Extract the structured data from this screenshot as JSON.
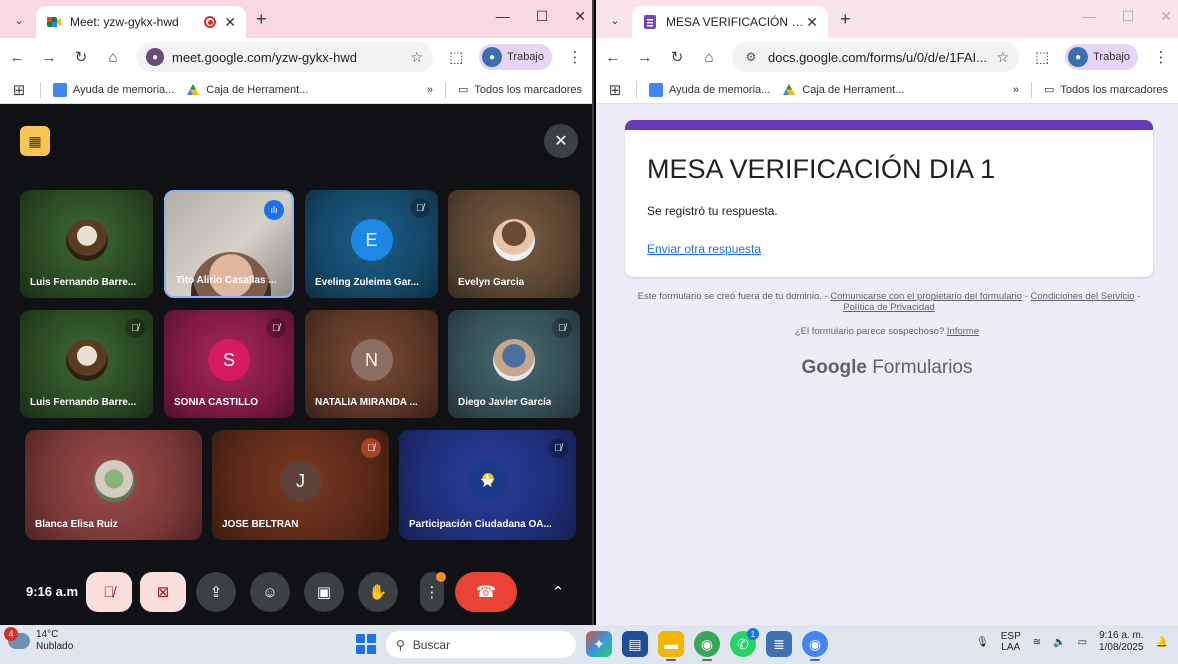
{
  "left_window": {
    "tab_title": "Meet: yzw-gykx-hwd",
    "url": "meet.google.com/yzw-gykx-hwd",
    "profile": "Trabajo",
    "bookmarks": [
      "Ayuda de memoria...",
      "Caja de Herrament..."
    ],
    "all_bookmarks": "Todos los marcadores",
    "more_bookmarks": "»"
  },
  "right_window": {
    "tab_title": "MESA VERIFICACIÓN DIA 1",
    "url": "docs.google.com/forms/u/0/d/e/1FAI...",
    "profile": "Trabajo",
    "bookmarks": [
      "Ayuda de memoria...",
      "Caja de Herrament..."
    ],
    "all_bookmarks": "Todos los marcadores",
    "more_bookmarks": "»"
  },
  "meet": {
    "participants": [
      {
        "name": "Luis Fernando Barre...",
        "type": "photo",
        "muted": false
      },
      {
        "name": "Tito Alirio Casallas ...",
        "type": "video",
        "speaking": true
      },
      {
        "name": "Eveling Zuleima Gar...",
        "initial": "E",
        "muted": true,
        "avatar_color": "#1e88e5"
      },
      {
        "name": "Evelyn Garcia",
        "type": "photo",
        "muted": false
      },
      {
        "name": "Luis Fernando Barre...",
        "type": "photo",
        "muted": true
      },
      {
        "name": "SONIA CASTILLO",
        "initial": "S",
        "muted": true,
        "avatar_color": "#d81b60"
      },
      {
        "name": "NATALIA MIRANDA ...",
        "initial": "N",
        "muted": false,
        "avatar_color": "#795548"
      },
      {
        "name": "Diego Javier García",
        "type": "photo",
        "muted": true
      },
      {
        "name": "Blanca Elisa Ruiz",
        "type": "photo",
        "muted": false
      },
      {
        "name": "JOSE BELTRAN",
        "initial": "J",
        "muted": true,
        "avatar_color": "#5d4037"
      },
      {
        "name": "Participación Ciudadana OA...",
        "type": "photo",
        "muted": true
      }
    ],
    "clock": "9:16 a.m"
  },
  "form": {
    "title": "MESA VERIFICACIÓN DIA 1",
    "message": "Se registró tu respuesta.",
    "link": "Enviar otra respuesta",
    "legal_prefix": "Este formulario se creó fuera de tu dominio. - ",
    "legal_contact": "Comunicarse con el propietario del formulario",
    "legal_sep1": " - ",
    "legal_terms": "Condiciones del Servicio",
    "legal_sep2": " - ",
    "legal_privacy": "Política de Privacidad",
    "suspicious": "¿El formulario parece sospechoso?",
    "report": "Informe",
    "brand_google": "Google",
    "brand_forms": "Formularios"
  },
  "taskbar": {
    "weather_badge": "4",
    "temperature": "14°C",
    "condition": "Nublado",
    "search_placeholder": "Buscar",
    "lang_top": "ESP",
    "lang_bottom": "LAA",
    "time": "9:16 a. m.",
    "date": "1/08/2025",
    "whatsapp_badge": "1"
  },
  "colors": {
    "form_accent": "#673ab7",
    "end_call": "#ea4335",
    "mic_off_bg": "#f9dedc"
  }
}
